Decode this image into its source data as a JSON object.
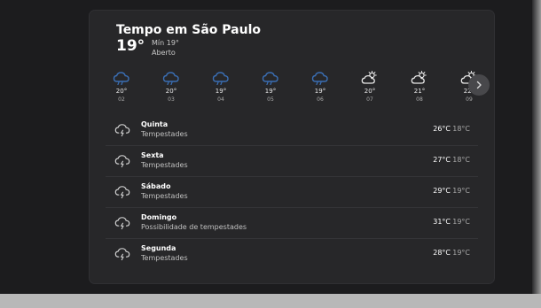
{
  "header": {
    "title": "Tempo em São Paulo",
    "temperature": "19°",
    "min": "Mín 19°",
    "condition": "Aberto"
  },
  "hourly": [
    {
      "icon": "rain-cloud-icon",
      "temp": "20°",
      "label": "02"
    },
    {
      "icon": "rain-cloud-icon",
      "temp": "20°",
      "label": "03"
    },
    {
      "icon": "rain-cloud-icon",
      "temp": "19°",
      "label": "04"
    },
    {
      "icon": "rain-cloud-icon",
      "temp": "19°",
      "label": "05"
    },
    {
      "icon": "rain-cloud-icon",
      "temp": "19°",
      "label": "06"
    },
    {
      "icon": "partly-sunny-icon",
      "temp": "20°",
      "label": "07"
    },
    {
      "icon": "partly-sunny-icon",
      "temp": "21°",
      "label": "08"
    },
    {
      "icon": "partly-sunny-icon",
      "temp": "22°",
      "label": "09"
    }
  ],
  "daily": [
    {
      "day": "Quinta",
      "condition": "Tempestades",
      "high": "26°C",
      "low": "18°C"
    },
    {
      "day": "Sexta",
      "condition": "Tempestades",
      "high": "27°C",
      "low": "18°C"
    },
    {
      "day": "Sábado",
      "condition": "Tempestades",
      "high": "29°C",
      "low": "19°C"
    },
    {
      "day": "Domingo",
      "condition": "Possibilidade de tempestades",
      "high": "31°C",
      "low": "19°C"
    },
    {
      "day": "Segunda",
      "condition": "Tempestades",
      "high": "28°C",
      "low": "19°C"
    }
  ],
  "colors": {
    "card_bg": "#272729",
    "rain_icon": "#3a6fb5",
    "sun_icon": "#e8e8e8"
  }
}
